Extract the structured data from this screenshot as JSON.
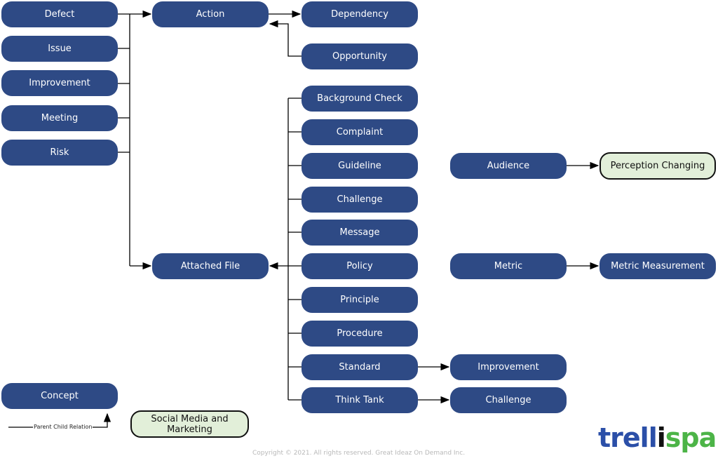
{
  "nodes": {
    "defect": "Defect",
    "issue": "Issue",
    "improvement": "Improvement",
    "meeting": "Meeting",
    "risk": "Risk",
    "action": "Action",
    "attached_file": "Attached File",
    "dependency": "Dependency",
    "opportunity": "Opportunity",
    "background_check": "Background Check",
    "complaint": "Complaint",
    "guideline": "Guideline",
    "challenge": "Challenge",
    "message": "Message",
    "policy": "Policy",
    "principle": "Principle",
    "procedure": "Procedure",
    "standard": "Standard",
    "think_tank": "Think Tank",
    "audience": "Audience",
    "perception_changing": "Perception Changing",
    "metric": "Metric",
    "metric_measurement": "Metric Measurement",
    "standard_improvement": "Improvement",
    "think_tank_challenge": "Challenge",
    "concept": "Concept",
    "social_media": "Social Media and Marketing"
  },
  "legend": {
    "label": "Parent Child Relation"
  },
  "footer": {
    "copyright": "Copyright © 2021. All rights reserved. Great Ideaz On Demand Inc."
  },
  "logo": {
    "part1": "trell",
    "part2": "i",
    "part3": "spark",
    "colors": {
      "trell": "#2b4fa8",
      "i": "#111111",
      "spark": "#4cb447"
    }
  },
  "colors": {
    "node": "#2e4a85",
    "highlight_node": "#e2efd9"
  }
}
